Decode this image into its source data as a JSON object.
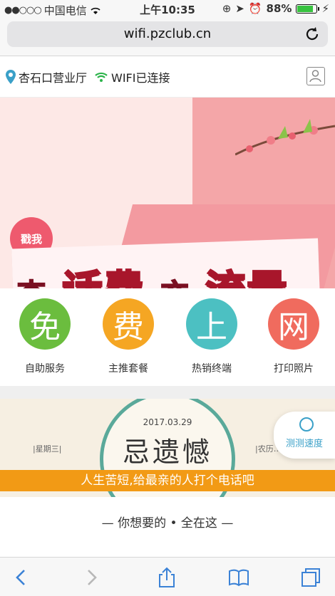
{
  "status": {
    "carrier": "中国电信",
    "time": "上午10:35",
    "battery": "88%"
  },
  "browser": {
    "url": "wifi.pzclub.cn"
  },
  "header": {
    "location": "杏石口营业厅",
    "wifi_status": "WIFI已连接"
  },
  "banner": {
    "badge": "戳我",
    "title_parts": [
      "查",
      "话费",
      "充",
      "流量"
    ]
  },
  "services": [
    {
      "char": "免",
      "label": "自助服务",
      "color": "#6bbd3e"
    },
    {
      "char": "费",
      "label": "主推套餐",
      "color": "#f5a623"
    },
    {
      "char": "上",
      "label": "热销终端",
      "color": "#4cc0c2"
    },
    {
      "char": "网",
      "label": "打印照片",
      "color": "#f06b5e"
    }
  ],
  "quote": {
    "date": "2017.03.29",
    "weekday": "|星期三|",
    "lunar": "|农历…",
    "headline": "忌遗憾",
    "message": "人生苦短,给最亲的人打个电话吧"
  },
  "speed_test": {
    "label": "测测速度"
  },
  "tagline": "— 你想要的 • 全在这 —",
  "colors": {
    "accent_orange": "#f29a15",
    "ios_blue": "#3b82d6",
    "wifi_green": "#2bb34a",
    "pin_teal": "#3aa0c8"
  }
}
